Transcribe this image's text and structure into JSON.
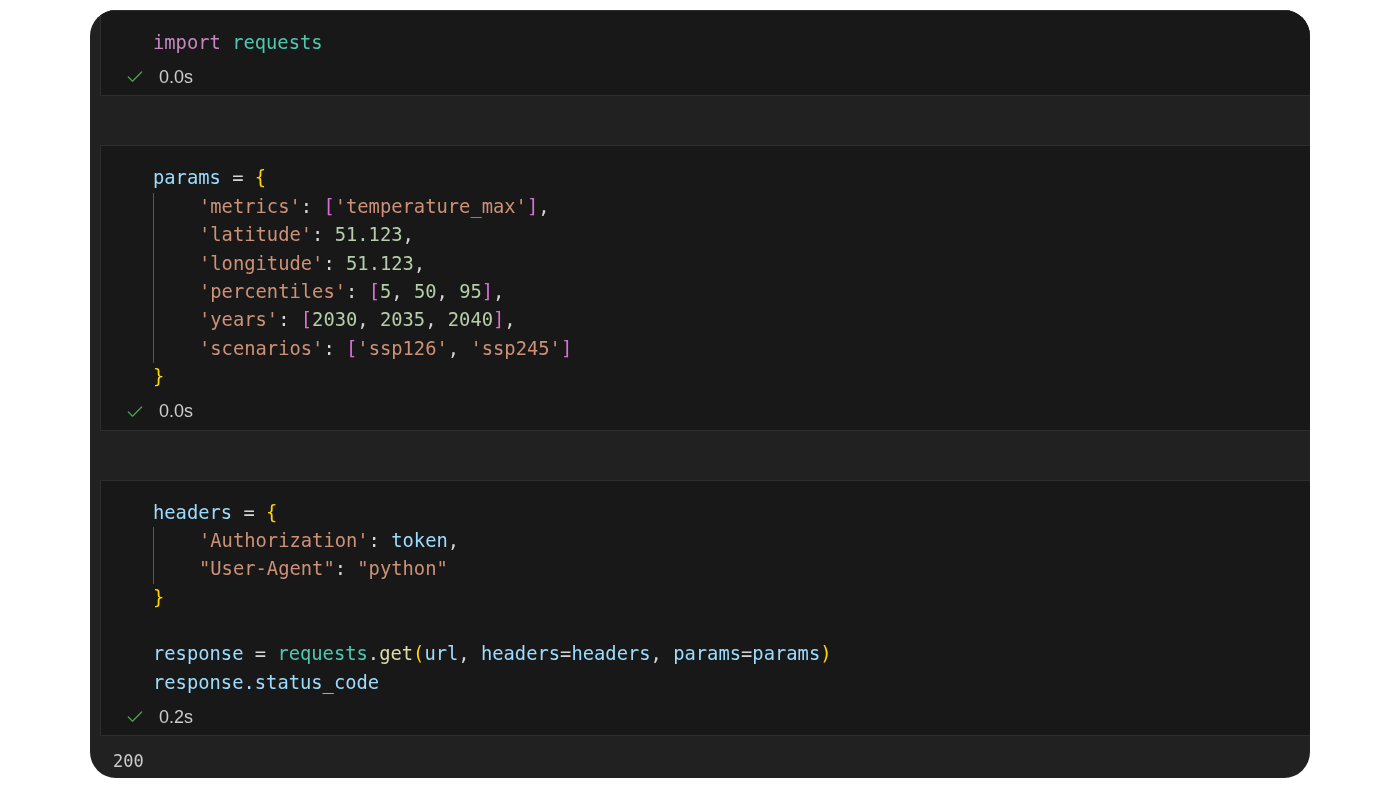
{
  "cells": [
    {
      "success": true,
      "duration": "0.0s",
      "lines": [
        {
          "tokens": [
            {
              "kind": "keyword",
              "text": "import"
            },
            {
              "kind": "module",
              "text": "requests",
              "space_before": true
            }
          ]
        }
      ]
    },
    {
      "success": true,
      "duration": "0.0s",
      "lines": [
        {
          "tokens": [
            {
              "kind": "variable",
              "text": "params"
            },
            {
              "kind": "plain",
              "text": " = "
            },
            {
              "kind": "brace",
              "text": "{"
            }
          ],
          "children": [
            {
              "tokens": [
                {
                  "kind": "string",
                  "text": "'metrics'"
                },
                {
                  "kind": "plain",
                  "text": ": "
                },
                {
                  "kind": "bracket",
                  "text": "["
                },
                {
                  "kind": "string",
                  "text": "'temperature_max'"
                },
                {
                  "kind": "bracket",
                  "text": "]"
                },
                {
                  "kind": "plain",
                  "text": ","
                }
              ]
            },
            {
              "tokens": [
                {
                  "kind": "string",
                  "text": "'latitude'"
                },
                {
                  "kind": "plain",
                  "text": ": "
                },
                {
                  "kind": "number",
                  "text": "51.123"
                },
                {
                  "kind": "plain",
                  "text": ","
                }
              ]
            },
            {
              "tokens": [
                {
                  "kind": "string",
                  "text": "'longitude'"
                },
                {
                  "kind": "plain",
                  "text": ": "
                },
                {
                  "kind": "number",
                  "text": "51.123"
                },
                {
                  "kind": "plain",
                  "text": ","
                }
              ]
            },
            {
              "tokens": [
                {
                  "kind": "string",
                  "text": "'percentiles'"
                },
                {
                  "kind": "plain",
                  "text": ": "
                },
                {
                  "kind": "bracket",
                  "text": "["
                },
                {
                  "kind": "number",
                  "text": "5"
                },
                {
                  "kind": "plain",
                  "text": ", "
                },
                {
                  "kind": "number",
                  "text": "50"
                },
                {
                  "kind": "plain",
                  "text": ", "
                },
                {
                  "kind": "number",
                  "text": "95"
                },
                {
                  "kind": "bracket",
                  "text": "]"
                },
                {
                  "kind": "plain",
                  "text": ","
                }
              ]
            },
            {
              "tokens": [
                {
                  "kind": "string",
                  "text": "'years'"
                },
                {
                  "kind": "plain",
                  "text": ": "
                },
                {
                  "kind": "bracket",
                  "text": "["
                },
                {
                  "kind": "number",
                  "text": "2030"
                },
                {
                  "kind": "plain",
                  "text": ", "
                },
                {
                  "kind": "number",
                  "text": "2035"
                },
                {
                  "kind": "plain",
                  "text": ", "
                },
                {
                  "kind": "number",
                  "text": "2040"
                },
                {
                  "kind": "bracket",
                  "text": "]"
                },
                {
                  "kind": "plain",
                  "text": ","
                }
              ]
            },
            {
              "tokens": [
                {
                  "kind": "string",
                  "text": "'scenarios'"
                },
                {
                  "kind": "plain",
                  "text": ": "
                },
                {
                  "kind": "bracket",
                  "text": "["
                },
                {
                  "kind": "string",
                  "text": "'ssp126'"
                },
                {
                  "kind": "plain",
                  "text": ", "
                },
                {
                  "kind": "string",
                  "text": "'ssp245'"
                },
                {
                  "kind": "bracket",
                  "text": "]"
                }
              ]
            }
          ]
        },
        {
          "tokens": [
            {
              "kind": "brace",
              "text": "}"
            }
          ]
        }
      ]
    },
    {
      "success": true,
      "duration": "0.2s",
      "lines": [
        {
          "tokens": [
            {
              "kind": "variable",
              "text": "headers"
            },
            {
              "kind": "plain",
              "text": " = "
            },
            {
              "kind": "brace",
              "text": "{"
            }
          ],
          "children": [
            {
              "tokens": [
                {
                  "kind": "string",
                  "text": "'Authorization'"
                },
                {
                  "kind": "plain",
                  "text": ": "
                },
                {
                  "kind": "variable",
                  "text": "token"
                },
                {
                  "kind": "plain",
                  "text": ","
                }
              ]
            },
            {
              "tokens": [
                {
                  "kind": "string",
                  "text": "\"User-Agent\""
                },
                {
                  "kind": "plain",
                  "text": ": "
                },
                {
                  "kind": "string",
                  "text": "\"python\""
                }
              ]
            }
          ]
        },
        {
          "tokens": [
            {
              "kind": "brace",
              "text": "}"
            }
          ]
        },
        {
          "space_above": true,
          "tokens": [
            {
              "kind": "variable",
              "text": "response"
            },
            {
              "kind": "plain",
              "text": " = "
            },
            {
              "kind": "module",
              "text": "requests"
            },
            {
              "kind": "plain",
              "text": "."
            },
            {
              "kind": "function",
              "text": "get"
            },
            {
              "kind": "brace",
              "text": "("
            },
            {
              "kind": "variable",
              "text": "url"
            },
            {
              "kind": "plain",
              "text": ", "
            },
            {
              "kind": "variable",
              "text": "headers"
            },
            {
              "kind": "plain",
              "text": "="
            },
            {
              "kind": "variable",
              "text": "headers"
            },
            {
              "kind": "plain",
              "text": ", "
            },
            {
              "kind": "variable",
              "text": "params"
            },
            {
              "kind": "plain",
              "text": "="
            },
            {
              "kind": "variable",
              "text": "params"
            },
            {
              "kind": "brace",
              "text": ")"
            }
          ]
        },
        {
          "tokens": [
            {
              "kind": "variable",
              "text": "response.status_code"
            }
          ]
        }
      ]
    }
  ],
  "output": "200"
}
